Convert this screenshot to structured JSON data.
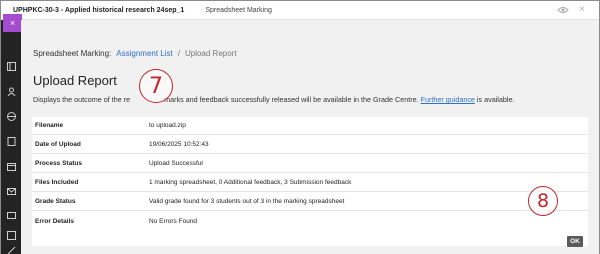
{
  "topbar": {
    "course_title": "UPHPKC-30-3 - Applied historical research 24sep_1",
    "page_name": "Spreadsheet Marking",
    "close_glyph": "×"
  },
  "sidebar": {
    "close_glyph": "×",
    "icons": [
      "layout-icon",
      "user-icon",
      "globe-icon",
      "document-icon",
      "calendar-icon",
      "mail-icon",
      "chat-icon",
      "grades-icon",
      "edit-icon"
    ]
  },
  "breadcrumb": {
    "root": "Spreadsheet Marking:",
    "link": "Assignment List",
    "separator": "/",
    "current": "Upload Report"
  },
  "title": "Upload Report",
  "description": {
    "before": "Displays the outcome of the re",
    "after": "marks and feedback successfully released will be available in the Grade Centre. ",
    "link": "Further guidance",
    "end": " is available."
  },
  "markers": {
    "first": "7",
    "second": "8"
  },
  "report": {
    "rows": [
      {
        "label": "Filename",
        "value": "to upload.zip"
      },
      {
        "label": "Date of Upload",
        "value": "19/06/2025 10:52:43"
      },
      {
        "label": "Process Status",
        "value": "Upload Successful"
      },
      {
        "label": "Files Included",
        "value": "1 marking spreadsheet, 0 Additional feedback, 3 Submission feedback"
      },
      {
        "label": "Grade Status",
        "value": "Valid grade found for 3 students out of 3 in the marking spreadsheet"
      },
      {
        "label": "Error Details",
        "value": "No Errors Found"
      }
    ]
  },
  "ok_label": "OK",
  "colors": {
    "accent": "#a34bd1",
    "link": "#2f6fc7",
    "marker": "#c0262c"
  }
}
